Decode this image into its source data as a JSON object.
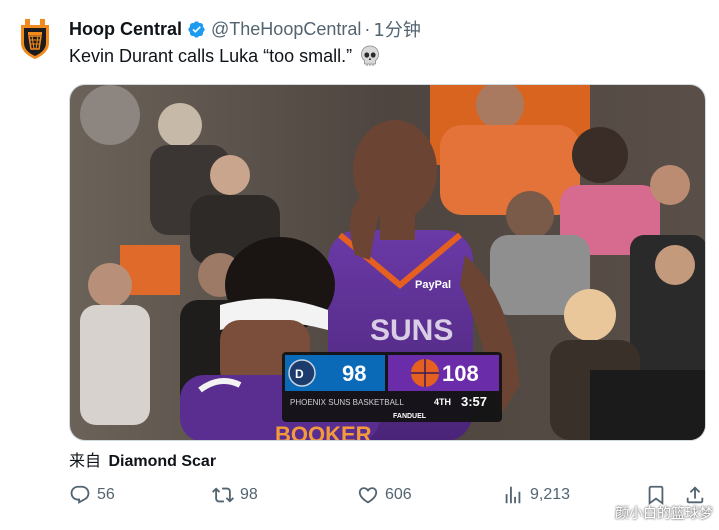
{
  "author": {
    "name": "Hoop Central",
    "handle": "@TheHoopCentral",
    "separator": "·",
    "time": "1分钟",
    "avatar_icon": "hoop-central-logo",
    "verified_icon": "verified-badge-icon",
    "verified_color": "#1d9bf0"
  },
  "tweet": {
    "text": "Kevin Durant calls Luka “too small.”",
    "emoji_icon": "skull-emoji"
  },
  "media": {
    "jersey_sponsor": "PayPal",
    "jersey_name": "BOOKER",
    "scorebug": {
      "away_score": "98",
      "home_score": "108",
      "broadcast_label": "PHOENIX SUNS BASKETBALL",
      "quarter": "4TH",
      "clock": "3:57",
      "sponsor": "FANDUEL",
      "away_color": "#0a6ab8",
      "home_color": "#6a2ca8"
    }
  },
  "source": {
    "prefix": "来自",
    "app": "Diamond Scar"
  },
  "actions": {
    "replies": "56",
    "retweets": "98",
    "likes": "606",
    "views": "9,213",
    "reply_icon": "reply-icon",
    "retweet_icon": "retweet-icon",
    "like_icon": "heart-icon",
    "views_icon": "views-icon",
    "bookmark_icon": "bookmark-icon",
    "share_icon": "share-icon"
  },
  "watermark": "颜小白的篮球梦",
  "colors": {
    "text_primary": "#0f1419",
    "text_secondary": "#536471",
    "suns_purple": "#5a2d91",
    "suns_orange": "#e56020"
  }
}
